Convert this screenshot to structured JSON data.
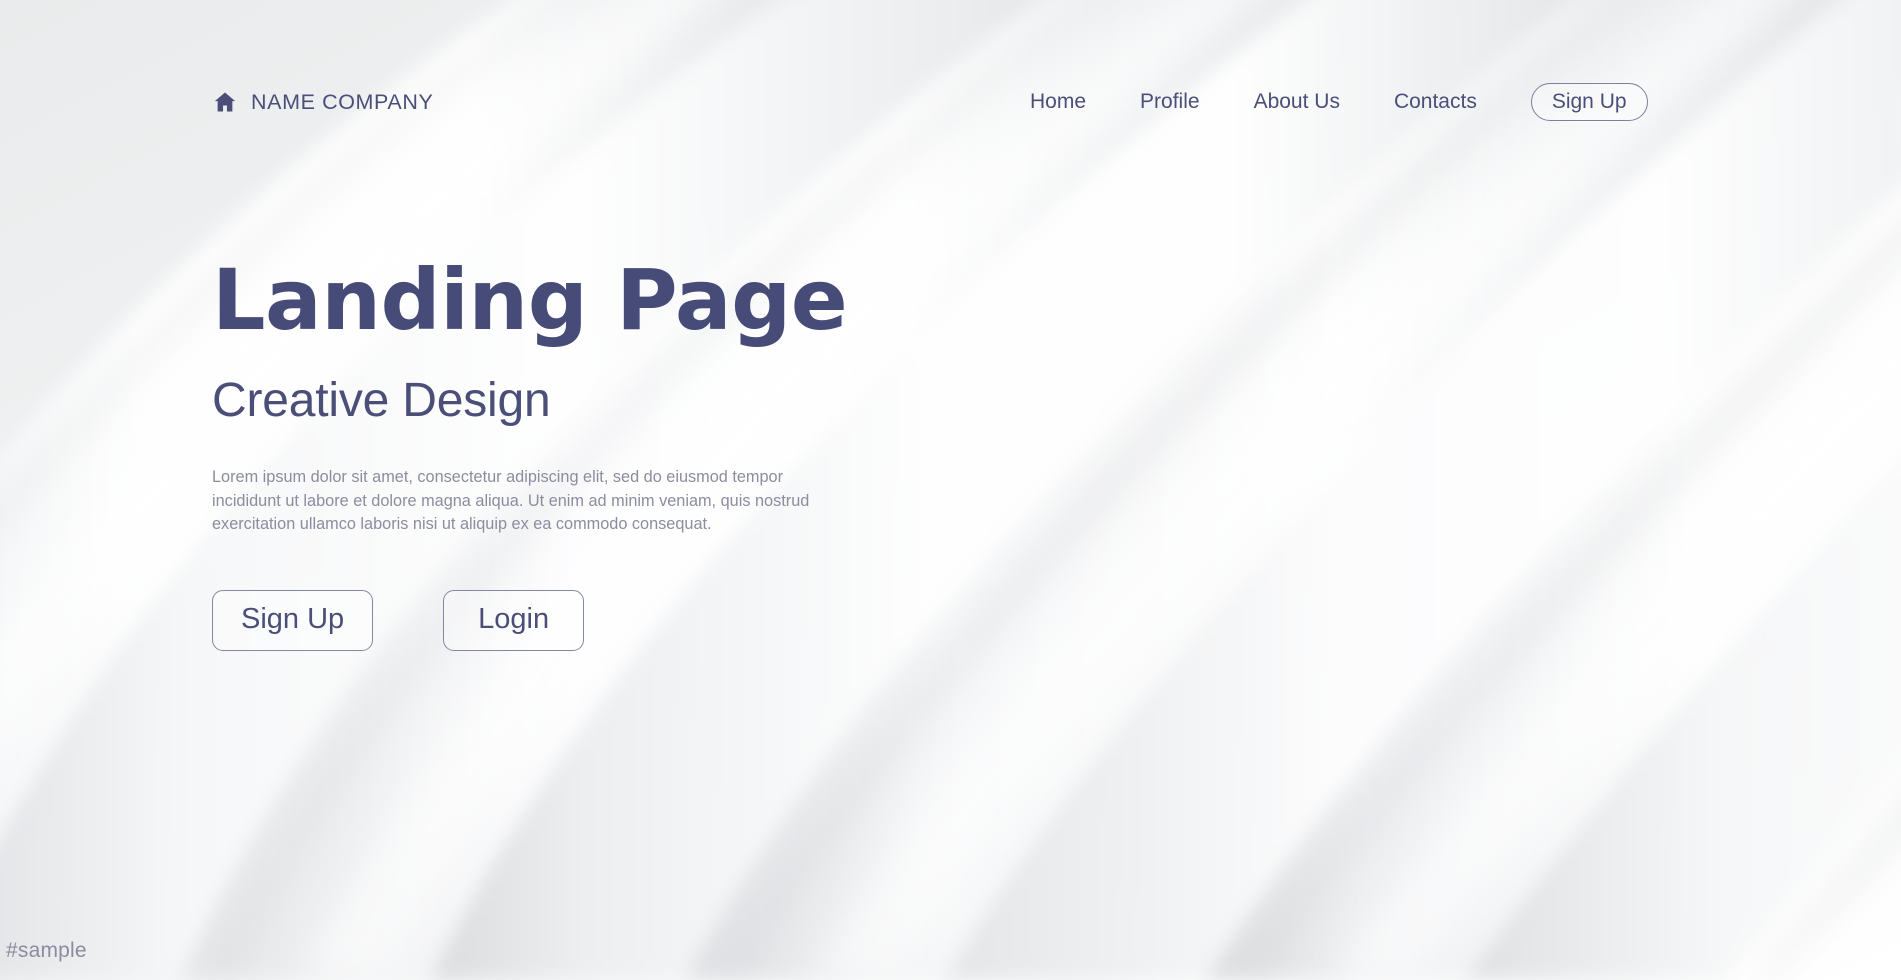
{
  "theme": {
    "accent": "#4b4f78",
    "heading": "#474b78",
    "body_text": "#8b8c9f",
    "border": "#8488a4",
    "background": "#eef0f1"
  },
  "header": {
    "brand": {
      "icon": "home-icon",
      "name": "NAME COMPANY"
    },
    "nav_items": [
      {
        "label": "Home"
      },
      {
        "label": "Profile"
      },
      {
        "label": "About Us"
      },
      {
        "label": "Contacts"
      }
    ],
    "signup_label": "Sign Up"
  },
  "hero": {
    "title": "Landing Page",
    "subtitle": "Creative Design",
    "paragraph": "Lorem ipsum dolor sit amet, consectetur adipiscing elit, sed do eiusmod tempor incididunt ut labore et dolore magna aliqua. Ut enim ad minim veniam, quis nostrud exercitation ullamco laboris nisi ut aliquip ex ea commodo consequat.",
    "primary_button": "Sign Up",
    "secondary_button": "Login"
  },
  "watermark": "#sample"
}
